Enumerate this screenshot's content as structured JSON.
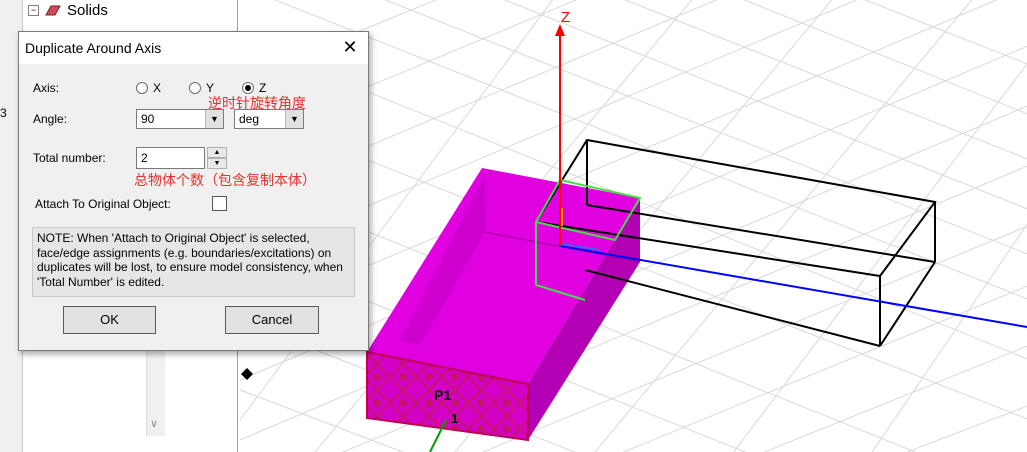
{
  "tree": {
    "expander": "−",
    "solids_label": "Solids",
    "row_digit": "3"
  },
  "dialog": {
    "title": "Duplicate Around Axis",
    "close": "✕",
    "axis_label": "Axis:",
    "axis_options": [
      "X",
      "Y",
      "Z"
    ],
    "axis_selected": "Z",
    "angle_label": "Angle:",
    "angle_value": "90",
    "angle_unit": "deg",
    "total_label": "Total number:",
    "total_value": "2",
    "attach_label": "Attach To Original Object:",
    "attach_checked": false,
    "note": "NOTE:  When 'Attach to Original Object' is selected, face/edge assignments (e.g. boundaries/excitations) on duplicates will be lost, to ensure model consistency, when 'Total Number' is edited.",
    "ok_label": "OK",
    "cancel_label": "Cancel"
  },
  "annotations": {
    "angle_note": "逆时针旋转角度",
    "count_note": "总物体个数（包含复制本体）"
  },
  "scene": {
    "z_axis_label": "Z",
    "port_label": "P1",
    "port_number": "1",
    "colors": {
      "grid": "#d8d8d8",
      "box_fill": "#d800d8",
      "box_dark": "#a800a8",
      "face_red": "#c2187a",
      "z_axis": "#ff0000",
      "x_axis": "#0000ff",
      "y_axis": "#00a000",
      "highlight": "#44dd44"
    }
  }
}
